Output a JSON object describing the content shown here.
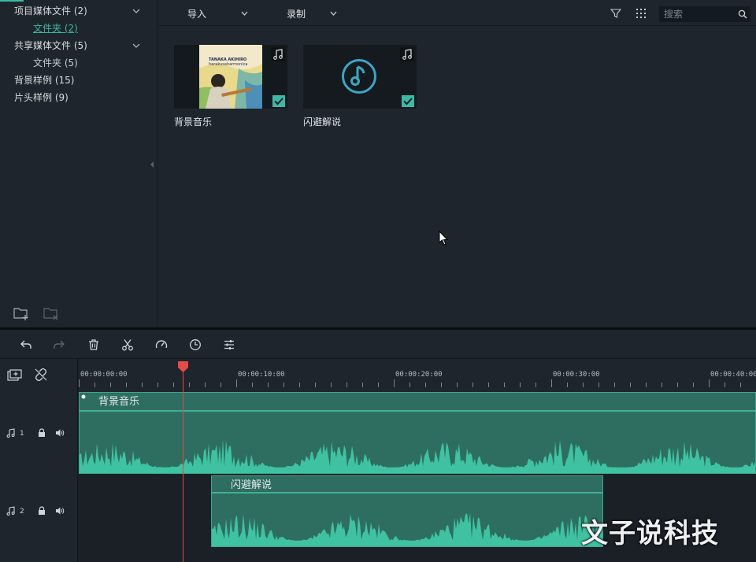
{
  "sidebar": {
    "items": [
      {
        "label": "项目媒体文件 (2)"
      },
      {
        "label": "文件夹 (2)"
      },
      {
        "label": "共享媒体文件 (5)"
      },
      {
        "label": "文件夹 (5)"
      },
      {
        "label": "背景样例 (15)"
      },
      {
        "label": "片头样例 (9)"
      }
    ]
  },
  "toolbar": {
    "import_label": "导入",
    "record_label": "录制",
    "search_placeholder": "搜索"
  },
  "media": {
    "items": [
      {
        "label": "背景音乐",
        "album_line1": "TANAKA AKIHIRO",
        "album_line2": "harakusaharmonica",
        "icon": "music-note-icon",
        "selected": true
      },
      {
        "label": "闪避解说",
        "icon": "music-disc-icon",
        "selected": true
      }
    ]
  },
  "timeline": {
    "ruler": [
      "00:00:00:00",
      "00:00:10:00",
      "00:00:20:00",
      "00:00:30:00",
      "00:00:40:00"
    ],
    "tracks": [
      {
        "number": "1",
        "clip_name": "背景音乐"
      },
      {
        "number": "2",
        "clip_name": "闪避解说"
      }
    ]
  },
  "watermark": "文子说科技",
  "colors": {
    "accent": "#3db8a4",
    "clip_fill": "#2e6e60",
    "waveform": "#3fc2a2",
    "playhead": "#e04848",
    "background": "#1f252c"
  }
}
